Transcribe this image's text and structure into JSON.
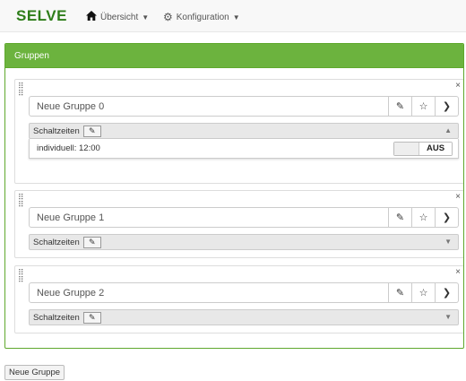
{
  "navbar": {
    "brand": "SELVE",
    "items": [
      {
        "label": "Übersicht",
        "icon": "home-icon"
      },
      {
        "label": "Konfiguration",
        "icon": "gear-icon"
      }
    ]
  },
  "panel": {
    "heading": "Gruppen",
    "heading_color": "#6cb33e",
    "groups": [
      {
        "name": "Neue Gruppe 0",
        "schedule_label": "Schaltzeiten",
        "expanded": true,
        "entry": "individuell: 12:00",
        "toggle_state": "AUS"
      },
      {
        "name": "Neue Gruppe 1",
        "schedule_label": "Schaltzeiten",
        "expanded": false
      },
      {
        "name": "Neue Gruppe 2",
        "schedule_label": "Schaltzeiten",
        "expanded": false
      }
    ]
  },
  "footer": {
    "new_group_label": "Neue Gruppe"
  }
}
